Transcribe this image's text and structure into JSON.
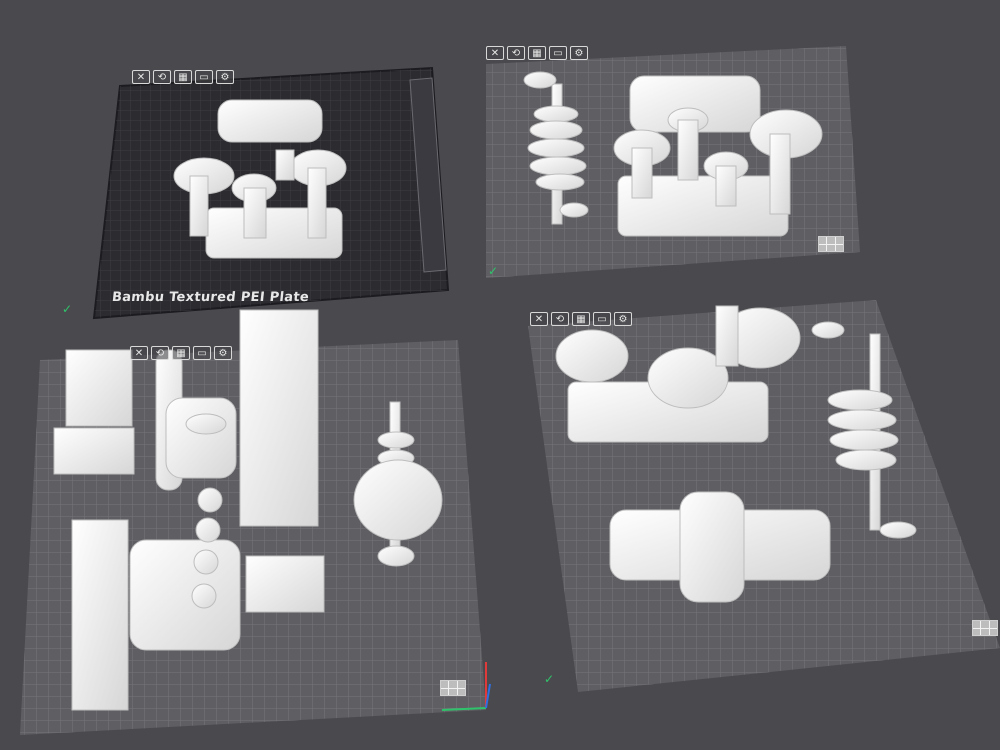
{
  "plate_label": "Bambu Textured PEI Plate",
  "plate_toolbar_icons": [
    "close-icon",
    "orient-icon",
    "arrange-icon",
    "toggle-icon",
    "settings-icon"
  ],
  "colors": {
    "background": "#4a4a4e",
    "plate_active": "#2b2b30",
    "plate_inactive": "#5e5e63",
    "grid": "#7a7a80",
    "model": "#f2f2f2",
    "accent": "#2fc46b"
  }
}
